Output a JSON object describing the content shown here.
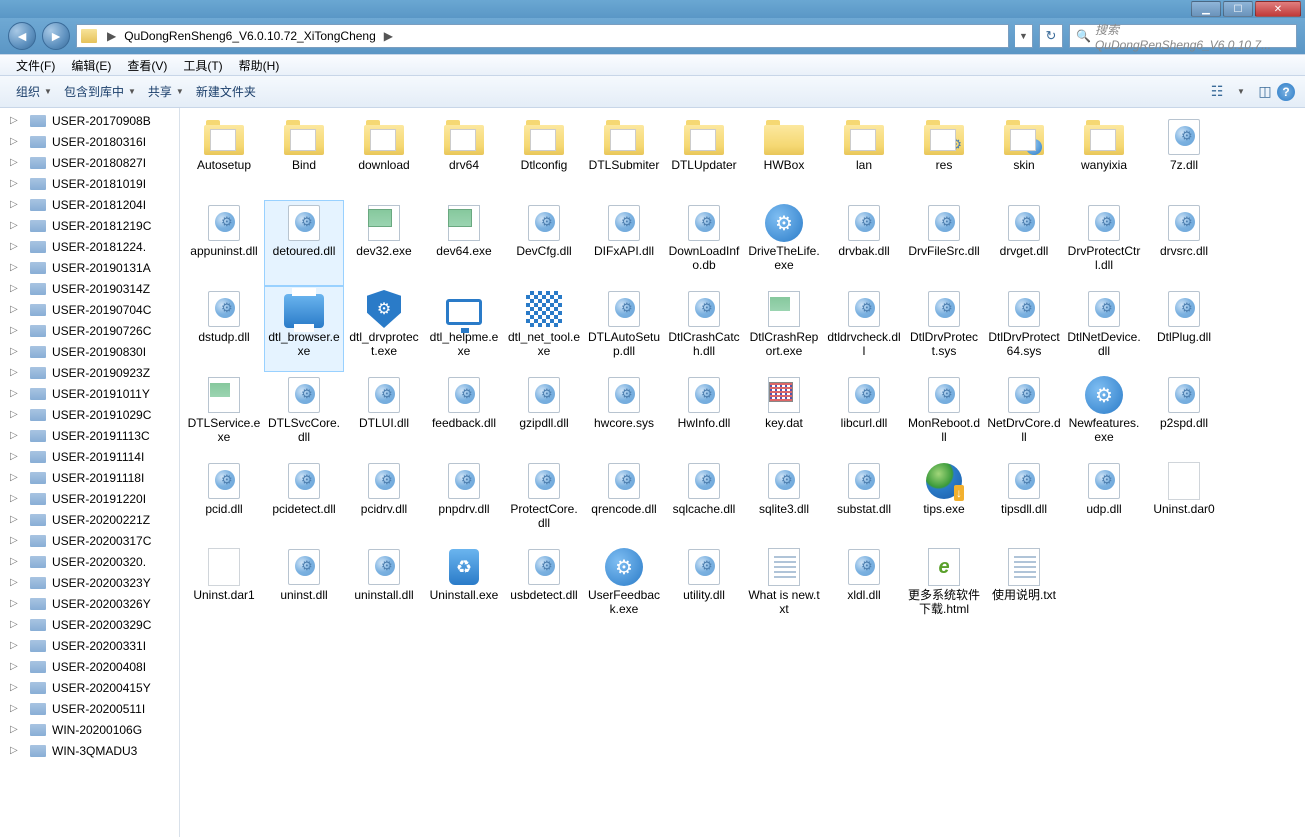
{
  "titlebar": {
    "min": "▁",
    "max": "☐",
    "close": "✕"
  },
  "nav": {
    "back": "◄",
    "fwd": "►",
    "path": "QuDongRenSheng6_V6.0.10.72_XiTongCheng",
    "arrow": "▶",
    "refresh": "↻",
    "dropdown": "▼"
  },
  "search": {
    "placeholder": "搜索 QuDongRenSheng6_V6.0.10.7...",
    "icon": "🔍"
  },
  "menu": {
    "file": "文件(F)",
    "edit": "编辑(E)",
    "view": "查看(V)",
    "tools": "工具(T)",
    "help": "帮助(H)"
  },
  "toolbar": {
    "organize": "组织",
    "include": "包含到库中",
    "share": "共享",
    "newfolder": "新建文件夹",
    "dd": "▼",
    "view_icon": "☷",
    "preview_icon": "◫",
    "help_icon": "?"
  },
  "sidebar_items": [
    "USER-20170908B",
    "USER-20180316I",
    "USER-20180827I",
    "USER-20181019I",
    "USER-20181204I",
    "USER-20181219C",
    "USER-20181224.",
    "USER-20190131A",
    "USER-20190314Z",
    "USER-20190704C",
    "USER-20190726C",
    "USER-20190830I",
    "USER-20190923Z",
    "USER-20191011Y",
    "USER-20191029C",
    "USER-20191113C",
    "USER-20191114I",
    "USER-20191118I",
    "USER-20191220I",
    "USER-20200221Z",
    "USER-20200317C",
    "USER-20200320.",
    "USER-20200323Y",
    "USER-20200326Y",
    "USER-20200329C",
    "USER-20200331I",
    "USER-20200408I",
    "USER-20200415Y",
    "USER-20200511I",
    "WIN-20200106G",
    "WIN-3QMADU3"
  ],
  "files": [
    {
      "n": "Autosetup",
      "t": "folder-open"
    },
    {
      "n": "Bind",
      "t": "folder-open"
    },
    {
      "n": "download",
      "t": "folder-open"
    },
    {
      "n": "drv64",
      "t": "folder-open"
    },
    {
      "n": "Dtlconfig",
      "t": "folder-open"
    },
    {
      "n": "DTLSubmiter",
      "t": "folder-open"
    },
    {
      "n": "DTLUpdater",
      "t": "folder-open"
    },
    {
      "n": "HWBox",
      "t": "folder"
    },
    {
      "n": "lan",
      "t": "folder-open"
    },
    {
      "n": "res",
      "t": "folder-gear"
    },
    {
      "n": "skin",
      "t": "folder-globe"
    },
    {
      "n": "wanyixia",
      "t": "folder-open"
    },
    {
      "n": "7z.dll",
      "t": "dll"
    },
    {
      "n": "appuninst.dll",
      "t": "dll"
    },
    {
      "n": "detoured.dll",
      "t": "dll",
      "sel": true
    },
    {
      "n": "dev32.exe",
      "t": "exe-green"
    },
    {
      "n": "dev64.exe",
      "t": "exe-green"
    },
    {
      "n": "DevCfg.dll",
      "t": "dll"
    },
    {
      "n": "DIFxAPI.dll",
      "t": "dll"
    },
    {
      "n": "DownLoadInfo.db",
      "t": "dll"
    },
    {
      "n": "DriveTheLife.exe",
      "t": "gear-blue"
    },
    {
      "n": "drvbak.dll",
      "t": "dll"
    },
    {
      "n": "DrvFileSrc.dll",
      "t": "dll"
    },
    {
      "n": "drvget.dll",
      "t": "dll"
    },
    {
      "n": "DrvProtectCtrl.dll",
      "t": "dll"
    },
    {
      "n": "drvsrc.dll",
      "t": "dll"
    },
    {
      "n": "dstudp.dll",
      "t": "dll"
    },
    {
      "n": "dtl_browser.exe",
      "t": "printer",
      "sel": true
    },
    {
      "n": "dtl_drvprotect.exe",
      "t": "shield"
    },
    {
      "n": "dtl_helpme.exe",
      "t": "monitor"
    },
    {
      "n": "dtl_net_tool.exe",
      "t": "qr"
    },
    {
      "n": "DTLAutoSetup.dll",
      "t": "dll"
    },
    {
      "n": "DtlCrashCatch.dll",
      "t": "dll"
    },
    {
      "n": "DtlCrashReport.exe",
      "t": "report"
    },
    {
      "n": "dtldrvcheck.dll",
      "t": "dll"
    },
    {
      "n": "DtlDrvProtect.sys",
      "t": "dll"
    },
    {
      "n": "DtlDrvProtect64.sys",
      "t": "dll"
    },
    {
      "n": "DtlNetDevice.dll",
      "t": "dll"
    },
    {
      "n": "DtlPlug.dll",
      "t": "dll"
    },
    {
      "n": "DTLService.exe",
      "t": "report"
    },
    {
      "n": "DTLSvcCore.dll",
      "t": "dll"
    },
    {
      "n": "DTLUI.dll",
      "t": "dll"
    },
    {
      "n": "feedback.dll",
      "t": "dll"
    },
    {
      "n": "gzipdll.dll",
      "t": "dll"
    },
    {
      "n": "hwcore.sys",
      "t": "dll"
    },
    {
      "n": "HwInfo.dll",
      "t": "dll"
    },
    {
      "n": "key.dat",
      "t": "key"
    },
    {
      "n": "libcurl.dll",
      "t": "dll"
    },
    {
      "n": "MonReboot.dll",
      "t": "dll"
    },
    {
      "n": "NetDrvCore.dll",
      "t": "dll"
    },
    {
      "n": "Newfeatures.exe",
      "t": "gear-blue"
    },
    {
      "n": "p2spd.dll",
      "t": "dll"
    },
    {
      "n": "pcid.dll",
      "t": "dll"
    },
    {
      "n": "pcidetect.dll",
      "t": "dll"
    },
    {
      "n": "pcidrv.dll",
      "t": "dll"
    },
    {
      "n": "pnpdrv.dll",
      "t": "dll"
    },
    {
      "n": "ProtectCore.dll",
      "t": "dll"
    },
    {
      "n": "qrencode.dll",
      "t": "dll"
    },
    {
      "n": "sqlcache.dll",
      "t": "dll"
    },
    {
      "n": "sqlite3.dll",
      "t": "dll"
    },
    {
      "n": "substat.dll",
      "t": "dll"
    },
    {
      "n": "tips.exe",
      "t": "globe"
    },
    {
      "n": "tipsdll.dll",
      "t": "dll"
    },
    {
      "n": "udp.dll",
      "t": "dll"
    },
    {
      "n": "Uninst.dar0",
      "t": "blank"
    },
    {
      "n": "Uninst.dar1",
      "t": "blank"
    },
    {
      "n": "uninst.dll",
      "t": "dll"
    },
    {
      "n": "uninstall.dll",
      "t": "dll"
    },
    {
      "n": "Uninstall.exe",
      "t": "bin"
    },
    {
      "n": "usbdetect.dll",
      "t": "dll"
    },
    {
      "n": "UserFeedback.exe",
      "t": "gear-blue"
    },
    {
      "n": "utility.dll",
      "t": "dll"
    },
    {
      "n": "What is new.txt",
      "t": "txt"
    },
    {
      "n": "xldl.dll",
      "t": "dll"
    },
    {
      "n": "更多系统软件下载.html",
      "t": "html"
    },
    {
      "n": "使用说明.txt",
      "t": "txt"
    }
  ]
}
